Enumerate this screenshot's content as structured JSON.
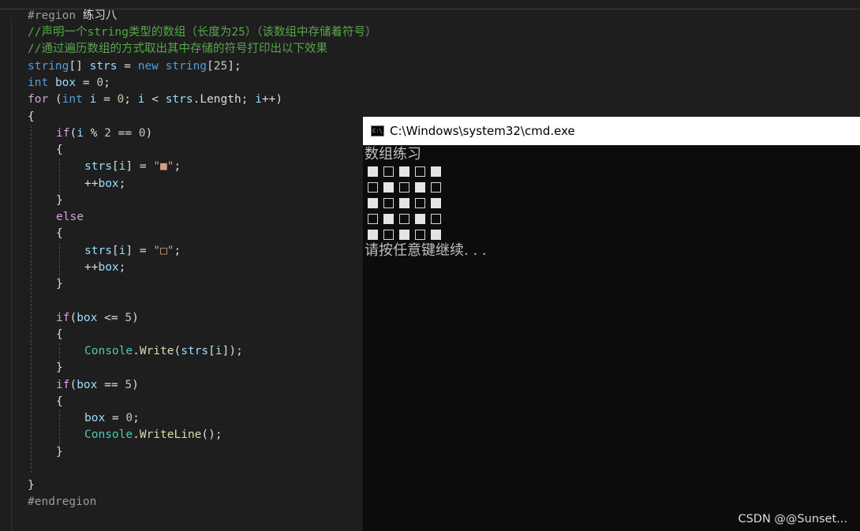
{
  "code": {
    "line1": {
      "pre": "#region",
      "title": "练习八"
    },
    "line2": "//声明一个string类型的数组（长度为25）（该数组中存储着符号）",
    "line3": "//通过遍历数组的方式取出其中存储的符号打印出以下效果",
    "line4": {
      "type": "string",
      "t1": "[] ",
      "name": "strs",
      "t2": " = ",
      "new": "new",
      "sp": " ",
      "type2": "string",
      "t3": "[",
      "n": "25",
      "t4": "];"
    },
    "line5": {
      "type": "int",
      "sp": " ",
      "name": "box",
      "t1": " = ",
      "n": "0",
      "t2": ";"
    },
    "line6": {
      "kw": "for",
      "t1": " (",
      "type": "int",
      "t2": " ",
      "v": "i",
      "t3": " = ",
      "n": "0",
      "t4": "; ",
      "v2": "i",
      "t5": " < ",
      "v3": "strs",
      "t6": ".Length; ",
      "v4": "i",
      "t7": "++)"
    },
    "line7": "{",
    "line8": {
      "kw": "if",
      "t1": "(",
      "v": "i",
      "t2": " % ",
      "n1": "2",
      "t3": " == ",
      "n2": "0",
      "t4": ")"
    },
    "line9": "{",
    "line10": {
      "v": "strs",
      "t1": "[",
      "v2": "i",
      "t2": "] = ",
      "s": "\"■\"",
      "t3": ";"
    },
    "line11": {
      "t1": "++",
      "v": "box",
      "t2": ";"
    },
    "line12": "}",
    "line13": "else",
    "line14": "{",
    "line15": {
      "v": "strs",
      "t1": "[",
      "v2": "i",
      "t2": "] = ",
      "s": "\"□\"",
      "t3": ";"
    },
    "line16": {
      "t1": "++",
      "v": "box",
      "t2": ";"
    },
    "line17": "}",
    "line19": {
      "kw": "if",
      "t1": "(",
      "v": "box",
      "t2": " <= ",
      "n": "5",
      "t3": ")"
    },
    "line20": "{",
    "line21": {
      "cls": "Console",
      "t1": ".",
      "m": "Write",
      "t2": "(",
      "v": "strs",
      "t3": "[",
      "v2": "i",
      "t4": "]);"
    },
    "line22": "}",
    "line23": {
      "kw": "if",
      "t1": "(",
      "v": "box",
      "t2": " == ",
      "n": "5",
      "t3": ")"
    },
    "line24": "{",
    "line25": {
      "v": "box",
      "t1": " = ",
      "n": "0",
      "t2": ";"
    },
    "line26": {
      "cls": "Console",
      "t1": ".",
      "m": "WriteLine",
      "t2": "();"
    },
    "line27": "}",
    "line29": "}",
    "line30": "#endregion"
  },
  "console": {
    "title": "C:\\Windows\\system32\\cmd.exe",
    "icon": "cmd-window-icon",
    "icon_text": "C:\\_",
    "heading": "数组练习",
    "grid": [
      [
        "■",
        "□",
        "■",
        "□",
        "■"
      ],
      [
        "□",
        "■",
        "□",
        "■",
        "□"
      ],
      [
        "■",
        "□",
        "■",
        "□",
        "■"
      ],
      [
        "□",
        "■",
        "□",
        "■",
        "□"
      ],
      [
        "■",
        "□",
        "■",
        "□",
        "■"
      ]
    ],
    "prompt": "请按任意键继续. . ."
  },
  "watermark": "CSDN @@Sunset..."
}
